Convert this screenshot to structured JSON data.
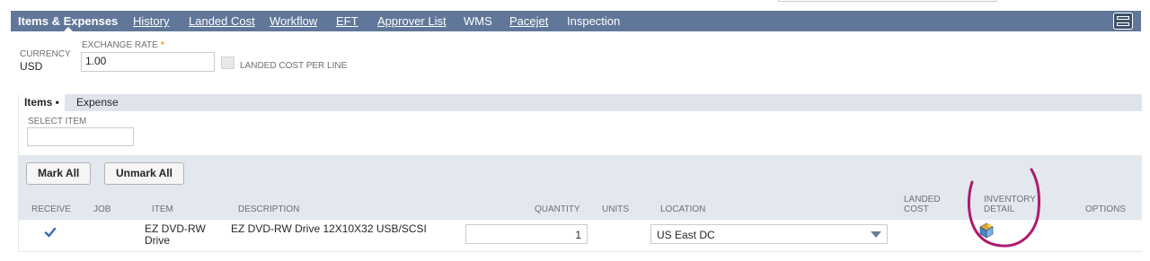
{
  "tabs": [
    {
      "label": "Items & Expenses",
      "active": true
    },
    {
      "label": "History"
    },
    {
      "label": "Landed Cost"
    },
    {
      "label": "Workflow"
    },
    {
      "label": "EFT"
    },
    {
      "label": "Approver List"
    },
    {
      "label": "WMS"
    },
    {
      "label": "Pacejet"
    },
    {
      "label": "Inspection"
    }
  ],
  "fields": {
    "currency_label": "CURRENCY",
    "currency_value": "USD",
    "exchange_rate_label": "EXCHANGE RATE",
    "exchange_rate_required": "*",
    "exchange_rate_value": "1.00",
    "landed_cost_per_line_label": "LANDED COST PER LINE"
  },
  "sublist": {
    "tabs": [
      {
        "label": "Items •",
        "active": true
      },
      {
        "label": "Expense"
      }
    ],
    "select_item_label": "SELECT ITEM",
    "select_item_value": "",
    "buttons": {
      "mark_all": "Mark All",
      "unmark_all": "Unmark All"
    },
    "columns": {
      "receive": "RECEIVE",
      "job": "JOB",
      "item": "ITEM",
      "description": "DESCRIPTION",
      "quantity": "QUANTITY",
      "units": "UNITS",
      "location": "LOCATION",
      "landed_cost_1": "LANDED",
      "landed_cost_2": "COST",
      "inventory_detail_1": "INVENTORY",
      "inventory_detail_2": "DETAIL",
      "options": "OPTIONS"
    },
    "row": {
      "receive_checked": true,
      "item_line1": "EZ DVD-RW",
      "item_line2": "Drive",
      "description": "EZ DVD-RW Drive 12X10X32 USB/SCSI",
      "quantity": "1",
      "location": "US East DC"
    }
  },
  "icons": {
    "checkmark": "checkmark-icon",
    "inventory_detail": "inventory-detail-icon",
    "dropdown": "chevron-down-icon",
    "toggle": "layout-toggle-icon"
  },
  "colors": {
    "tab_bar": "#607799",
    "sublist_bg": "#e3e8ef",
    "annotation": "#b01a6e",
    "required": "#e8a317"
  }
}
